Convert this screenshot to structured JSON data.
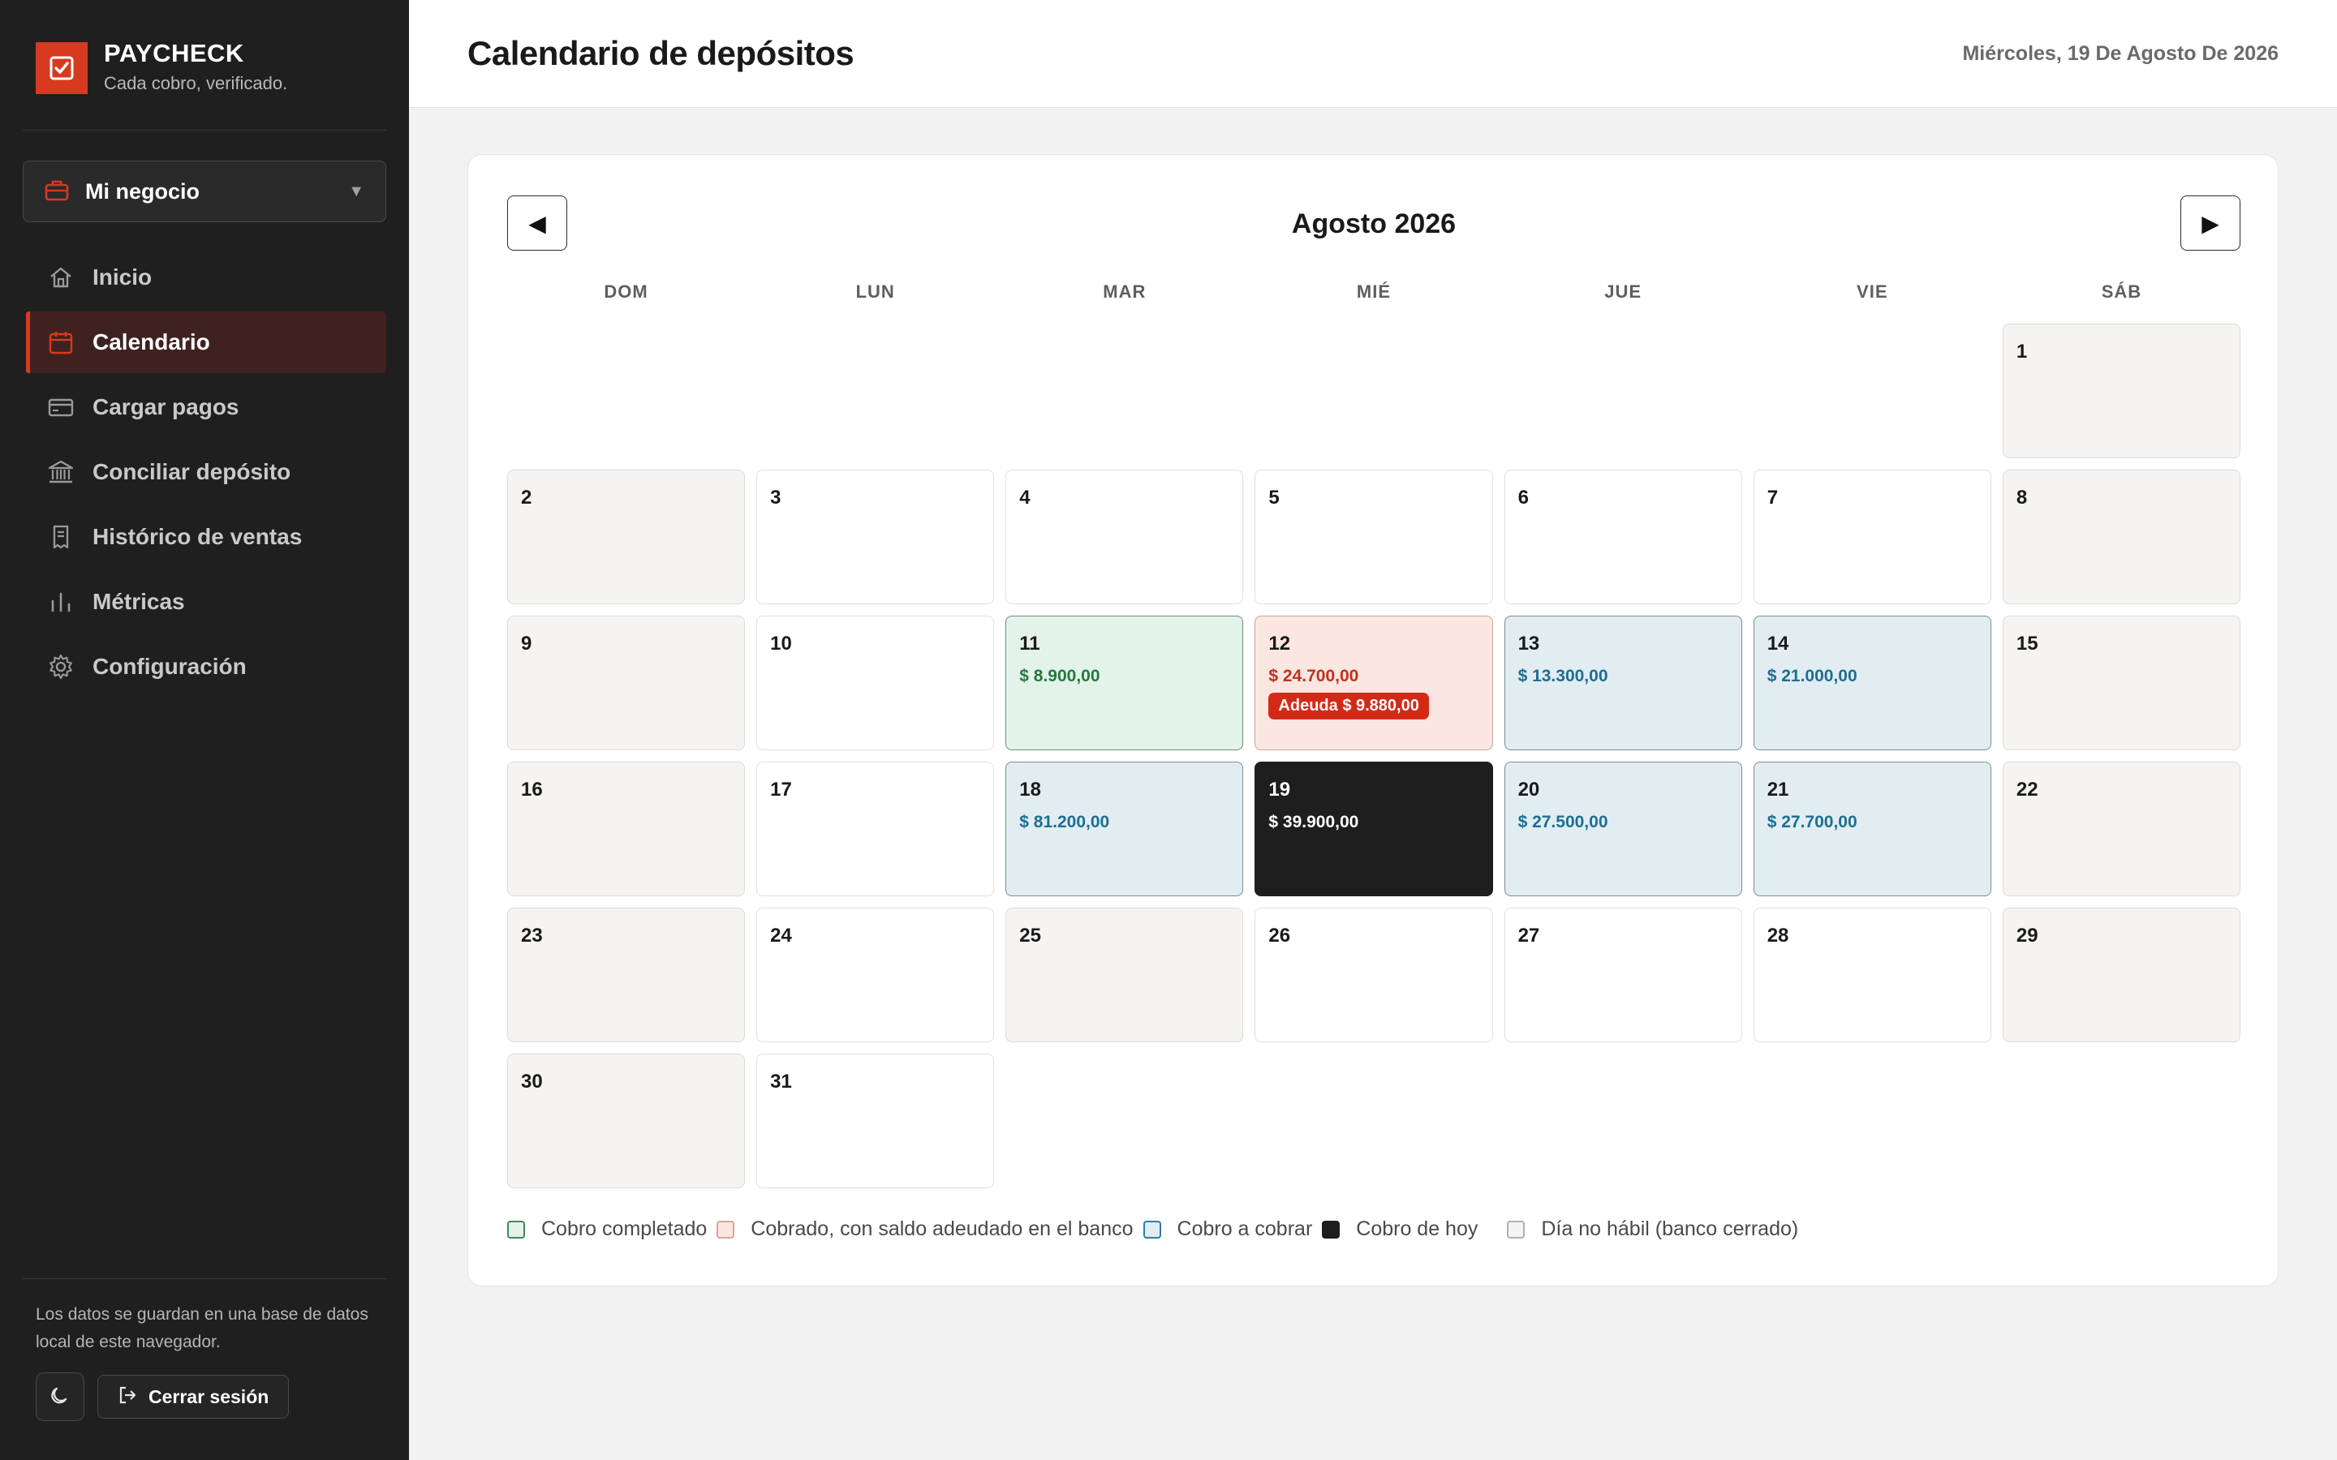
{
  "brand": {
    "name": "PAYCHECK",
    "tagline": "Cada cobro, verificado."
  },
  "business": {
    "label": "Mi negocio"
  },
  "nav": [
    {
      "label": "Inicio",
      "icon": "home-icon",
      "active": false
    },
    {
      "label": "Calendario",
      "icon": "calendar-icon",
      "active": true
    },
    {
      "label": "Cargar pagos",
      "icon": "card-icon",
      "active": false
    },
    {
      "label": "Conciliar depósito",
      "icon": "bank-icon",
      "active": false
    },
    {
      "label": "Histórico de ventas",
      "icon": "receipt-icon",
      "active": false
    },
    {
      "label": "Métricas",
      "icon": "chart-icon",
      "active": false
    },
    {
      "label": "Configuración",
      "icon": "gear-icon",
      "active": false
    }
  ],
  "sidebar_note": "Los datos se guardan en una base de datos local de este navegador.",
  "logout_label": "Cerrar sesión",
  "header": {
    "title": "Calendario de depósitos",
    "date": "Miércoles, 19 De Agosto De 2026"
  },
  "calendar": {
    "month_label": "Agosto 2026",
    "prev_glyph": "◀",
    "next_glyph": "▶",
    "weekdays": [
      "DOM",
      "LUN",
      "MAR",
      "MIÉ",
      "JUE",
      "VIE",
      "SÁB"
    ],
    "leading_blanks": 6,
    "days": [
      {
        "n": "1",
        "status": "nonwork"
      },
      {
        "n": "2",
        "status": "nonwork"
      },
      {
        "n": "3",
        "status": "none"
      },
      {
        "n": "4",
        "status": "none"
      },
      {
        "n": "5",
        "status": "none"
      },
      {
        "n": "6",
        "status": "none"
      },
      {
        "n": "7",
        "status": "none"
      },
      {
        "n": "8",
        "status": "nonwork"
      },
      {
        "n": "9",
        "status": "nonwork"
      },
      {
        "n": "10",
        "status": "none"
      },
      {
        "n": "11",
        "status": "done",
        "amount": "$ 8.900,00"
      },
      {
        "n": "12",
        "status": "owed",
        "amount": "$ 24.700,00",
        "badge": "Adeuda $ 9.880,00"
      },
      {
        "n": "13",
        "status": "pending",
        "amount": "$ 13.300,00"
      },
      {
        "n": "14",
        "status": "pending",
        "amount": "$ 21.000,00"
      },
      {
        "n": "15",
        "status": "nonwork"
      },
      {
        "n": "16",
        "status": "nonwork"
      },
      {
        "n": "17",
        "status": "none"
      },
      {
        "n": "18",
        "status": "pending",
        "amount": "$ 81.200,00"
      },
      {
        "n": "19",
        "status": "today",
        "amount": "$ 39.900,00"
      },
      {
        "n": "20",
        "status": "pending",
        "amount": "$ 27.500,00"
      },
      {
        "n": "21",
        "status": "pending",
        "amount": "$ 27.700,00"
      },
      {
        "n": "22",
        "status": "nonwork"
      },
      {
        "n": "23",
        "status": "nonwork"
      },
      {
        "n": "24",
        "status": "none"
      },
      {
        "n": "25",
        "status": "nonwork"
      },
      {
        "n": "26",
        "status": "none"
      },
      {
        "n": "27",
        "status": "none"
      },
      {
        "n": "28",
        "status": "none"
      },
      {
        "n": "29",
        "status": "nonwork"
      },
      {
        "n": "30",
        "status": "nonwork"
      },
      {
        "n": "31",
        "status": "none"
      }
    ]
  },
  "legend": [
    {
      "key": "done",
      "label": "Cobro completado"
    },
    {
      "key": "owed",
      "label": "Cobrado, con saldo adeudado en el banco"
    },
    {
      "key": "pending",
      "label": "Cobro a cobrar"
    },
    {
      "key": "today",
      "label": "Cobro de hoy"
    },
    {
      "key": "nonwork",
      "label": "Día no hábil (banco cerrado)"
    }
  ],
  "colors": {
    "accent": "#d63a1f",
    "sidebar_bg": "#1f1f1f",
    "done": "#237a3d",
    "owed": "#c0321a",
    "pending": "#1d6e92",
    "today": "#1e1e1e"
  }
}
